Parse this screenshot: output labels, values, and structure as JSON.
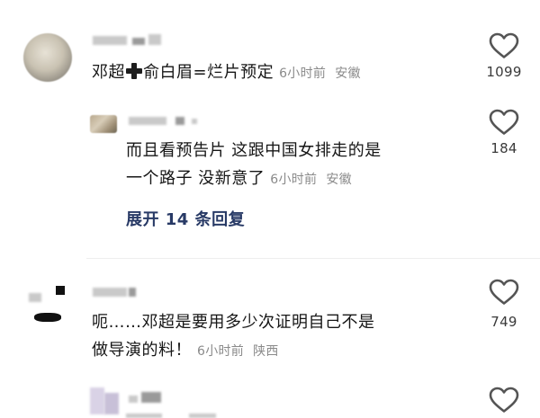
{
  "comments": [
    {
      "text_before": "邓超",
      "text_after": "俞白眉=烂片预定",
      "time": "6小时前",
      "location": "安徽",
      "likes": "1099"
    },
    {
      "text_line1": "而且看预告片 这跟中国女排走的是",
      "text_line2": "一个路子 没新意了",
      "time": "6小时前",
      "location": "安徽",
      "likes": "184"
    },
    {
      "text_line1": "呃……邓超是要用多少次证明自己不是",
      "text_line2": "做导演的料！",
      "time": "6小时前",
      "location": "陕西",
      "likes": "749"
    }
  ],
  "expand_replies": "展开 14 条回复",
  "icons": {
    "like": "heart-outline-icon",
    "plus": "plus-emoji-icon"
  },
  "colors": {
    "text": "#161616",
    "meta": "#8a8a8a",
    "expand": "#283a66",
    "heart": "#555555"
  }
}
